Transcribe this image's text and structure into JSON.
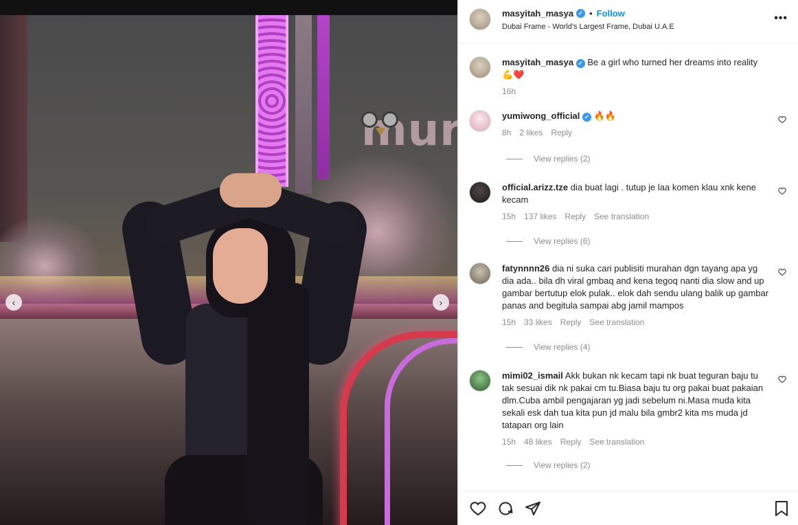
{
  "post": {
    "username": "masyitah_masya",
    "follow_label": "Follow",
    "location": "Dubai Frame - World's Largest Frame, Dubai U.A.E",
    "more_label": "•••",
    "caption_text": "Be a girl who turned her dreams into reality",
    "caption_emoji": "💪❤️",
    "caption_time": "16h"
  },
  "watermark_text": "murai",
  "comments": [
    {
      "username": "yumiwong_official",
      "text": "🔥🔥",
      "time": "8h",
      "likes": "2 likes",
      "reply": "Reply",
      "view_replies": "View replies (2)"
    },
    {
      "username": "official.arizz.tze",
      "text": "dia buat lagi . tutup je laa komen klau xnk kene kecam",
      "time": "15h",
      "likes": "137 likes",
      "reply": "Reply",
      "translation": "See translation",
      "view_replies": "View replies (6)"
    },
    {
      "username": "fatynnnn26",
      "text": "dia ni suka cari publisiti murahan dgn tayang apa yg dia ada.. bila dh viral gmbaq and kena tegoq nanti dia slow and up gambar bertutup elok pulak.. elok dah sendu ulang balik up gambar panas and begitula sampai abg jamil mampos",
      "time": "15h",
      "likes": "33 likes",
      "reply": "Reply",
      "translation": "See translation",
      "view_replies": "View replies (4)"
    },
    {
      "username": "mimi02_ismail",
      "text": "Akk bukan nk kecam tapi nk buat teguran baju tu tak sesuai dik nk pakai cm tu.Biasa baju tu org pakai buat pakaian dlm.Cuba ambil pengajaran yg jadi sebelum ni.Masa muda kita sekali esk dah tua kita pun jd malu bila gmbr2 kita ms muda jd tatapan org lain",
      "time": "15h",
      "likes": "48 likes",
      "reply": "Reply",
      "translation": "See translation",
      "view_replies": "View replies (2)"
    }
  ],
  "icons": {
    "verified": "verified-badge-icon",
    "like": "heart-outline-icon",
    "comment": "comment-bubble-icon",
    "share": "paper-plane-icon",
    "save": "bookmark-icon",
    "prev": "chevron-left-icon",
    "next": "chevron-right-icon"
  },
  "colors": {
    "link_blue": "#0095f6",
    "verified_blue": "#3897f0",
    "muted": "#8e8e8e"
  }
}
